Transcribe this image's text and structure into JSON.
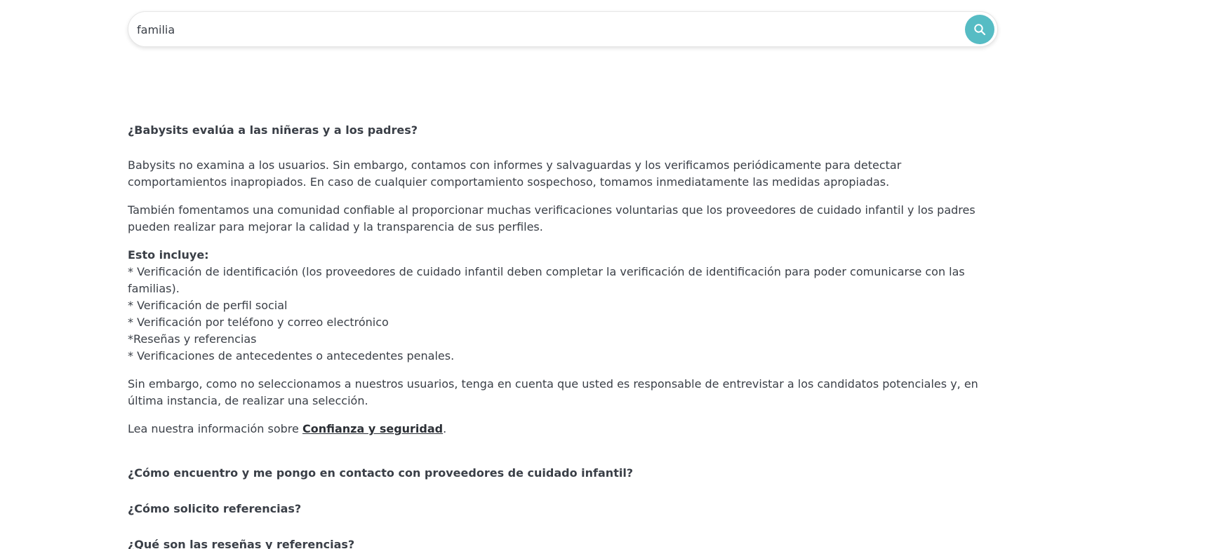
{
  "search": {
    "value": "familia",
    "icon": "search-icon",
    "button_color": "#56bcc4"
  },
  "faq": {
    "open_question": "¿Babysits evalúa a las niñeras y a los padres?",
    "answer": {
      "p1_line1": "Babysits no examina a los usuarios. Sin embargo, contamos con informes y salvaguardas y los verificamos periódicamente para detectar",
      "p1_line2": "comportamientos inapropiados. En caso de cualquier comportamiento sospechoso, tomamos inmediatamente las medidas apropiadas.",
      "p2_line1": "También fomentamos una comunidad confiable al proporcionar muchas verificaciones voluntarias que los proveedores de cuidado infantil y los padres",
      "p2_line2": "pueden realizar para mejorar la calidad y la transparencia de sus perfiles.",
      "includes_title": "Esto incluye:",
      "list_line1": "* Verificación de identificación (los proveedores de cuidado infantil deben completar la verificación de identificación para poder comunicarse con las",
      "list_line2": "familias).",
      "list_line3": "* Verificación de perfil social",
      "list_line4": "* Verificación por teléfono y correo electrónico",
      "list_line5": "*Reseñas y referencias",
      "list_line6": "* Verificaciones de antecedentes o antecedentes penales.",
      "p4_line1": "Sin embargo, como no seleccionamos a nuestros usuarios, tenga en cuenta que usted es responsable de entrevistar a los candidatos potenciales y, en",
      "p4_line2": "última instancia, de realizar una selección.",
      "p5_prefix": "Lea nuestra información sobre ",
      "p5_link": "Confianza y seguridad",
      "p5_suffix": "."
    },
    "questions": [
      "¿Cómo encuentro y me pongo en contacto con proveedores de cuidado infantil?",
      "¿Cómo solicito referencias?",
      "¿Qué son las reseñas y referencias?"
    ]
  }
}
